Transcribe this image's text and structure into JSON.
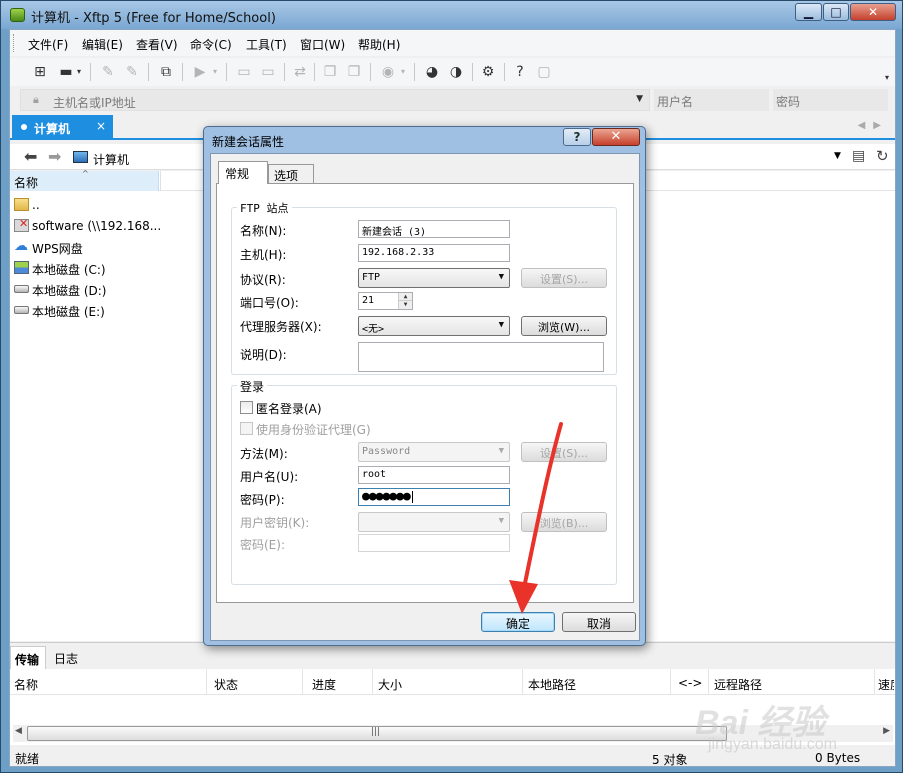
{
  "window": {
    "title": "计算机 - Xftp 5 (Free for Home/School)",
    "controls": {
      "minimize": "▁",
      "maximize": "□",
      "close": "✕"
    }
  },
  "menu": [
    "文件(F)",
    "编辑(E)",
    "查看(V)",
    "命令(C)",
    "工具(T)",
    "窗口(W)",
    "帮助(H)"
  ],
  "toolbar_icons": [
    "new-session-icon",
    "open-folder-icon",
    "connect-icon",
    "disconnect-icon",
    "new-tab-icon",
    "transfer-icon",
    "copy-icon",
    "paste-icon",
    "refresh-icon",
    "properties-icon",
    "globe-icon",
    "xshell-icon",
    "xftp-icon",
    "settings-icon",
    "help-icon",
    "chat-icon"
  ],
  "address": {
    "host_placeholder": "主机名或IP地址",
    "username_placeholder": "用户名",
    "password_placeholder": "密码"
  },
  "tab": {
    "label": "计算机",
    "close": "×"
  },
  "path": {
    "current": "计算机"
  },
  "file_pane": {
    "column_name": "名称",
    "items": [
      {
        "name": "..",
        "icon": "folder-icon"
      },
      {
        "name": "software (\\\\192.168...",
        "icon": "network-drive-icon"
      },
      {
        "name": "WPS网盘",
        "icon": "cloud-icon"
      },
      {
        "name": "本地磁盘 (C:)",
        "icon": "system-drive-icon"
      },
      {
        "name": "本地磁盘 (D:)",
        "icon": "drive-icon"
      },
      {
        "name": "本地磁盘 (E:)",
        "icon": "drive-icon"
      }
    ]
  },
  "transfer": {
    "tabs": {
      "transfer": "传输",
      "log": "日志"
    },
    "columns": [
      "名称",
      "状态",
      "进度",
      "大小",
      "本地路径",
      "<->",
      "远程路径",
      "速度"
    ]
  },
  "status": {
    "text": "就绪",
    "objects": "5 对象",
    "bytes": "0 Bytes"
  },
  "dialog": {
    "title": "新建会话属性",
    "help": "?",
    "close": "✕",
    "tabs": {
      "general": "常规",
      "options": "选项"
    },
    "ftp_group": {
      "title": "FTP 站点",
      "name_label": "名称(N):",
      "name_value": "新建会话 (3)",
      "host_label": "主机(H):",
      "host_value": "192.168.2.33",
      "protocol_label": "协议(R):",
      "protocol_value": "FTP",
      "settings_button": "设置(S)...",
      "port_label": "端口号(O):",
      "port_value": "21",
      "proxy_label": "代理服务器(X):",
      "proxy_value": "<无>",
      "browse_button": "浏览(W)...",
      "description_label": "说明(D):"
    },
    "login_group": {
      "title": "登录",
      "anonymous_label": "匿名登录(A)",
      "auth_agent_label": "使用身份验证代理(G)",
      "method_label": "方法(M):",
      "method_value": "Password",
      "settings_button": "设置(S)...",
      "username_label": "用户名(U):",
      "username_value": "root",
      "password_label": "密码(P):",
      "password_value": "●●●●●●●",
      "user_key_label": "用户密钥(K):",
      "browse_button": "浏览(B)...",
      "passphrase_label": "密码(E):"
    },
    "ok_button": "确定",
    "cancel_button": "取消"
  },
  "watermark": {
    "brand": "Bai 经验",
    "url": "jingyan.baidu.com"
  },
  "colors": {
    "tab_accent": "#1d8ee0",
    "arrow": "#e8322a",
    "titlebar": "#7aa7d2"
  }
}
